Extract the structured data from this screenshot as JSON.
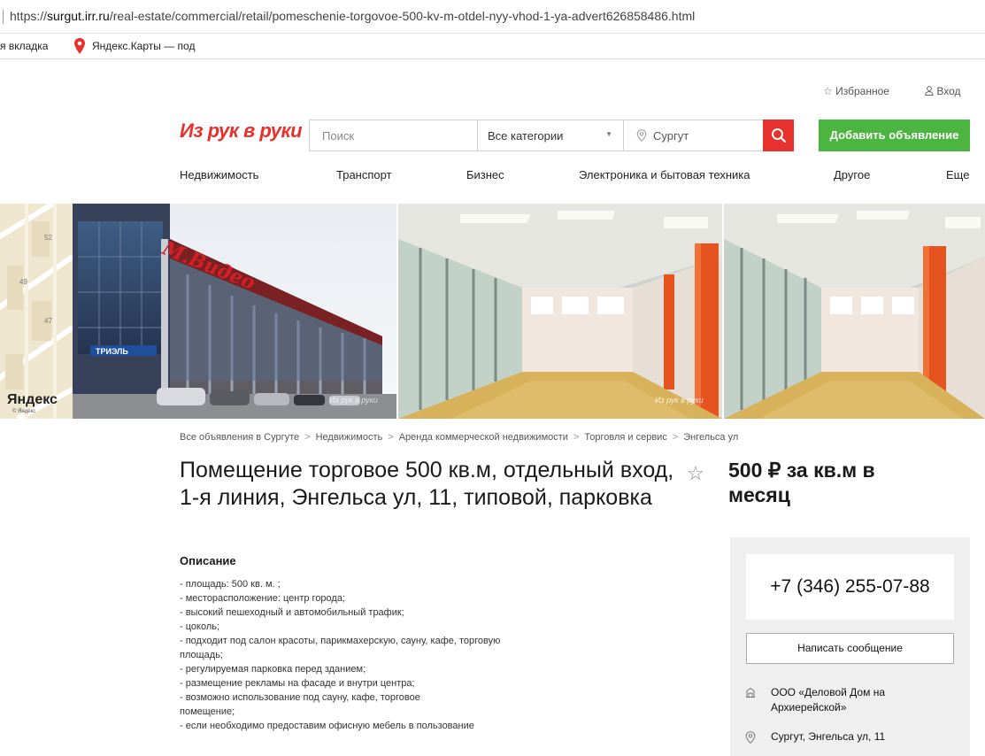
{
  "browser": {
    "url_prefix": "https://",
    "url_host": "surgut.irr.ru",
    "url_path": "/real-estate/commercial/retail/pomeschenie-torgovoe-500-kv-m-otdel-nyy-vhod-1-ya-advert626858486.html",
    "bookmark_1": "я вкладка",
    "bookmark_2": "Яндекс.Карты — под"
  },
  "header": {
    "favorites_label": "Избранное",
    "login_label": "Вход",
    "logo_text": "Из рук в руки",
    "search_placeholder": "Поиск",
    "category_label": "Все категории",
    "city_label": "Сургут",
    "add_ad_label": "Добавить объявление"
  },
  "nav": {
    "items": [
      "Недвижимость",
      "Транспорт",
      "Бизнес",
      "Электроника и бытовая техника",
      "Другое",
      "Еще"
    ]
  },
  "gallery": {
    "map_numbers": [
      "52",
      "49",
      "47"
    ],
    "map_brand": "Яндекс",
    "map_brand_small": "© Яндекс",
    "store_sign": "М.Видео",
    "shop_sign": "ТРИЭЛЬ",
    "watermark": "Из рук в руки"
  },
  "breadcrumbs": [
    "Все объявления в Сургуте",
    "Недвижимость",
    "Аренда коммерческой недвижимости",
    "Торговля и сервис",
    "Энгельса ул"
  ],
  "listing": {
    "title": "Помещение торговое 500 кв.м, отдельный вход, 1-я линия, Энгельса ул, 11, типовой, парковка",
    "price": "500 ₽ за кв.м в месяц",
    "description_heading": "Описание",
    "description_lines": [
      "- площадь: 500 кв. м. ;",
      "- месторасположение: центр города;",
      "- высокий пешеходный и автомобильный трафик;",
      "- цоколь;",
      "- подходит под салон красоты, парикмахерскую, сауну, кафе, торговую площадь;",
      "- регулируемая парковка перед зданием;",
      "- размещение рекламы на фасаде и внутри центра;",
      "- возможно использование под сауну, кафе, торговое помещение;",
      "- если необходимо предоставим офисную мебель в пользование"
    ]
  },
  "seller": {
    "phone": "+7 (346) 255-07-88",
    "message_button": "Написать сообщение",
    "company": "ООО «Деловой Дом на Архиерейской»",
    "address": "Сургут, Энгельса ул, 11"
  },
  "colors": {
    "brand_red": "#e8312d",
    "add_green": "#4cb53f",
    "panel_gray": "#efefef"
  }
}
